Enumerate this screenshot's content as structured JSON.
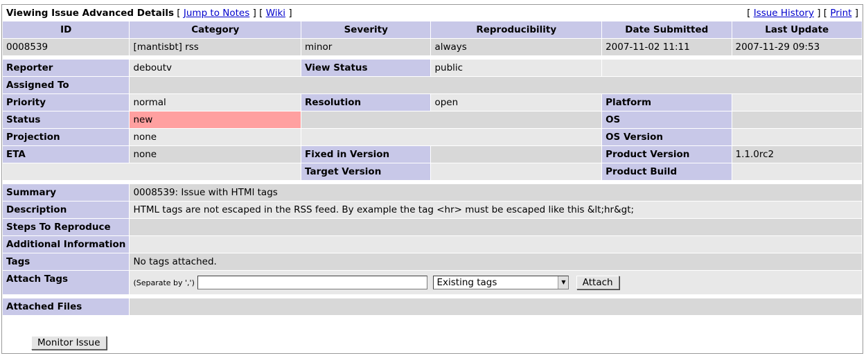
{
  "header": {
    "title": "Viewing Issue Advanced Details",
    "jump_to_notes": "Jump to Notes",
    "wiki": "Wiki",
    "issue_history": "Issue History",
    "print": "Print",
    "bl": "[",
    "br": "]",
    "sep": "] ["
  },
  "columns": [
    "ID",
    "Category",
    "Severity",
    "Reproducibility",
    "Date Submitted",
    "Last Update"
  ],
  "issue": {
    "id": "0008539",
    "category": "[mantisbt] rss",
    "severity": "minor",
    "reproducibility": "always",
    "date_submitted": "2007-11-02 11:11",
    "last_update": "2007-11-29 09:53"
  },
  "labels": {
    "reporter": "Reporter",
    "view_status": "View Status",
    "assigned_to": "Assigned To",
    "priority": "Priority",
    "resolution": "Resolution",
    "platform": "Platform",
    "status": "Status",
    "os": "OS",
    "projection": "Projection",
    "os_version": "OS Version",
    "eta": "ETA",
    "fixed_in_version": "Fixed in Version",
    "product_version": "Product Version",
    "target_version": "Target Version",
    "product_build": "Product Build",
    "summary": "Summary",
    "description": "Description",
    "steps": "Steps To Reproduce",
    "additional": "Additional Information",
    "tags": "Tags",
    "attach_tags": "Attach Tags",
    "attached_files": "Attached Files"
  },
  "values": {
    "reporter": "deboutv",
    "view_status": "public",
    "assigned_to": "",
    "priority": "normal",
    "resolution": "open",
    "platform": "",
    "status": "new",
    "os": "",
    "projection": "none",
    "os_version": "",
    "eta": "none",
    "fixed_in_version": "",
    "product_version": "1.1.0rc2",
    "target_version": "",
    "product_build": "",
    "summary": "0008539: Issue with HTMl tags",
    "description": "HTML tags are not escaped in the RSS feed. By example the tag <hr> must be escaped like this &lt;hr&gt;",
    "steps": "",
    "additional": "",
    "tags": "No tags attached."
  },
  "attach_tags": {
    "hint": "(Separate by ',')",
    "input_value": "",
    "select_value": "Existing tags",
    "button": "Attach"
  },
  "buttons": {
    "monitor": "Monitor Issue"
  },
  "colors": {
    "label_bg": "#c8c8e8",
    "row_dark": "#d8d8d8",
    "row_light": "#e8e8e8",
    "status_new": "#ffa0a0",
    "link": "#0000cc"
  }
}
